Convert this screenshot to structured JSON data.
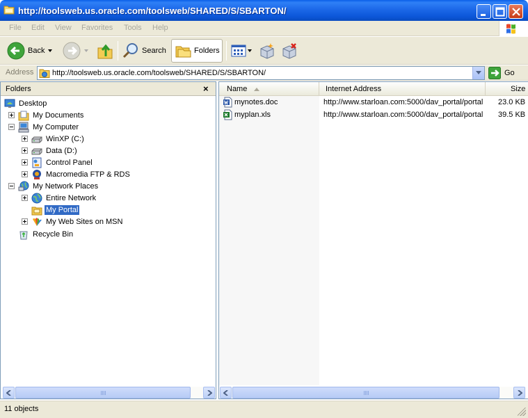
{
  "window": {
    "title": "http://toolsweb.us.oracle.com/toolsweb/SHARED/S/SBARTON/"
  },
  "menu": [
    "File",
    "Edit",
    "View",
    "Favorites",
    "Tools",
    "Help"
  ],
  "toolbar": {
    "back_label": "Back",
    "search_label": "Search",
    "folders_label": "Folders"
  },
  "address": {
    "label": "Address",
    "value": "http://toolsweb.us.oracle.com/toolsweb/SHARED/S/SBARTON/",
    "go_label": "Go"
  },
  "folders_pane": {
    "title": "Folders",
    "close_glyph": "×",
    "tree": [
      {
        "label": "Desktop",
        "icon": "desktop-icon"
      },
      {
        "label": "My Documents",
        "icon": "my-documents-icon"
      },
      {
        "label": "My Computer",
        "icon": "my-computer-icon"
      },
      {
        "label": "WinXP (C:)",
        "icon": "drive-icon"
      },
      {
        "label": "Data (D:)",
        "icon": "drive-icon"
      },
      {
        "label": "Control Panel",
        "icon": "control-panel-icon"
      },
      {
        "label": "Macromedia FTP & RDS",
        "icon": "ftp-icon"
      },
      {
        "label": "My Network Places",
        "icon": "network-places-icon"
      },
      {
        "label": "Entire Network",
        "icon": "globe-icon"
      },
      {
        "label": "My Portal",
        "icon": "portal-folder-icon",
        "selected": true
      },
      {
        "label": "My Web Sites on MSN",
        "icon": "msn-icon"
      },
      {
        "label": "Recycle Bin",
        "icon": "recycle-bin-icon"
      }
    ]
  },
  "files": {
    "columns": [
      "Name",
      "Internet Address",
      "Size"
    ],
    "rows": [
      {
        "name": "mynotes.doc",
        "url": "http://www.starloan.com:5000/dav_portal/portal",
        "size": "23.0 KB",
        "icon": "word-doc-icon"
      },
      {
        "name": "myplan.xls",
        "url": "http://www.starloan.com:5000/dav_portal/portal",
        "size": "39.5 KB",
        "icon": "excel-icon"
      }
    ]
  },
  "status": {
    "text": "11 objects"
  },
  "colors": {
    "titlebar": "#0a5fe8",
    "selection": "#316ac5",
    "chrome": "#ece9d8"
  }
}
